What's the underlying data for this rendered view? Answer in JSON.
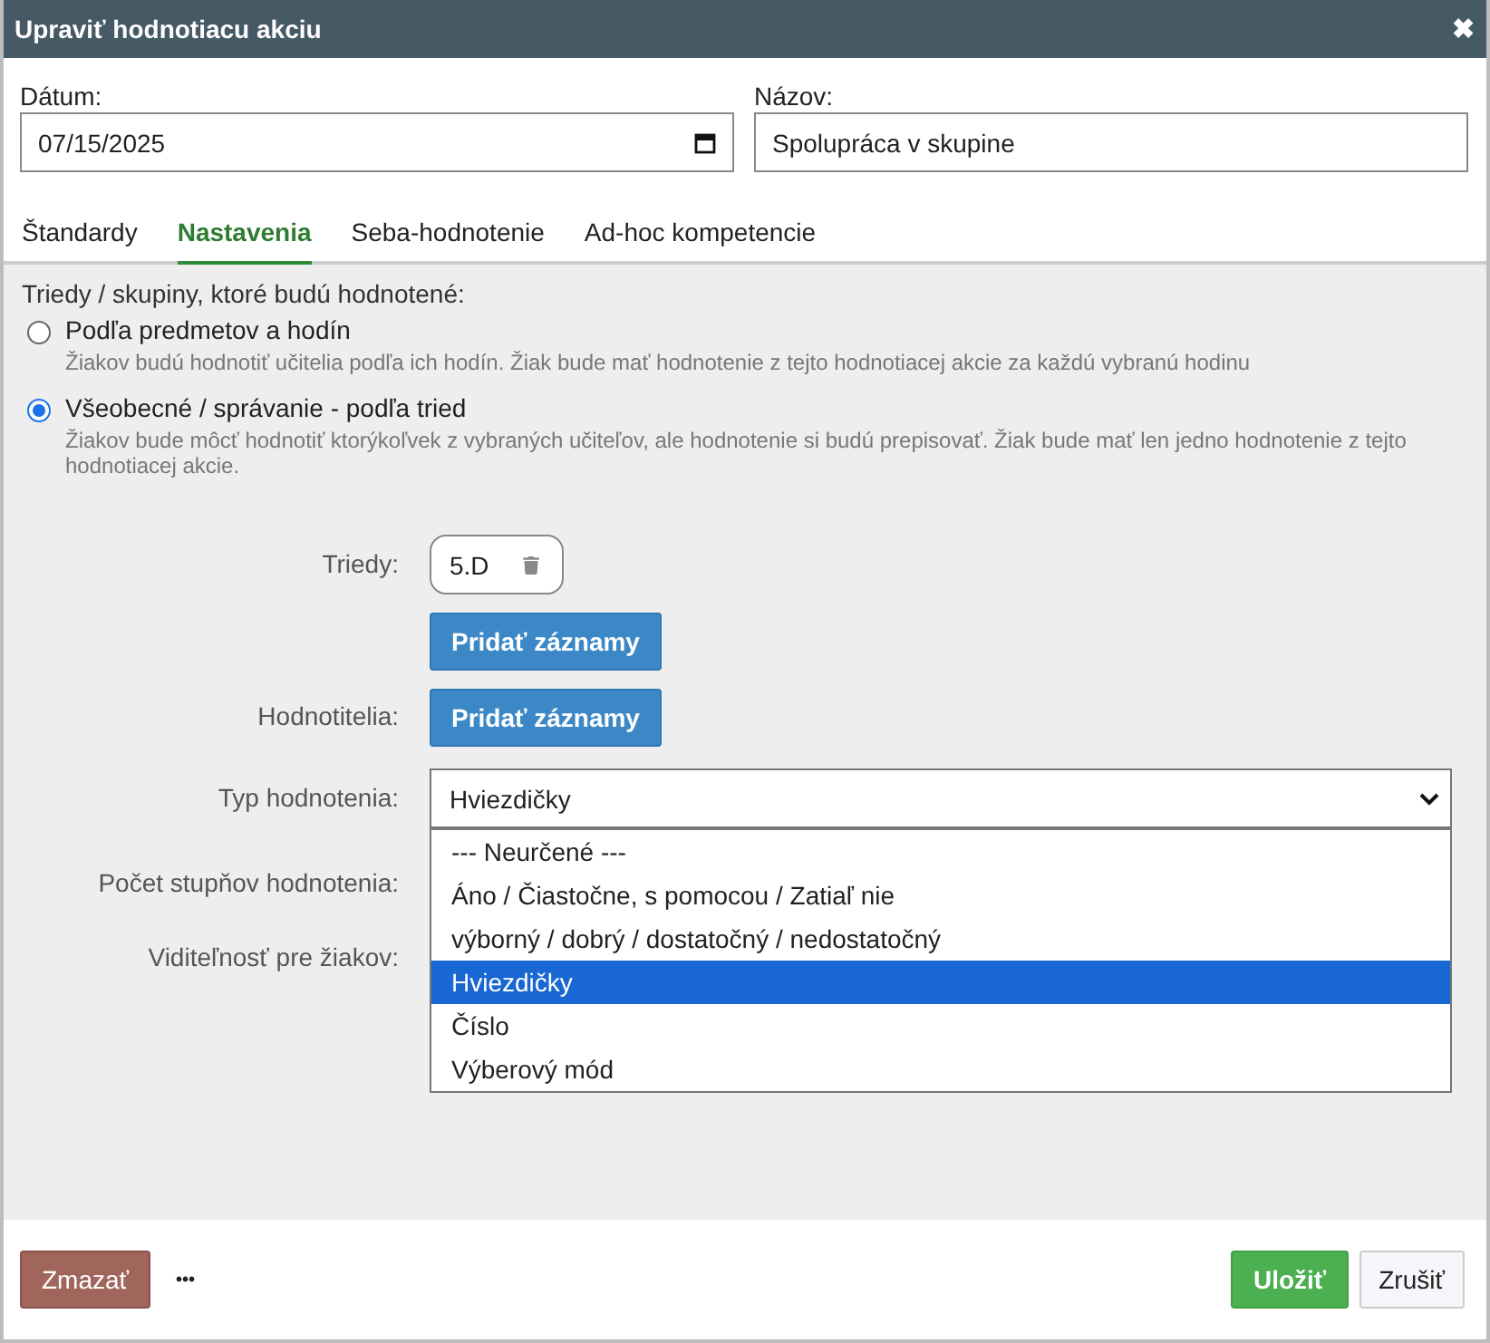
{
  "window": {
    "title": "Upraviť hodnotiacu akciu",
    "close": "✖"
  },
  "fields": [
    {
      "label": "Dátum:",
      "value": "07/15/2025",
      "kind": "date"
    },
    {
      "label": "Názov:",
      "value": "Spolupráca v skupine",
      "kind": "text"
    }
  ],
  "tabs": [
    {
      "label": "Štandardy",
      "selected": false
    },
    {
      "label": "Nastavenia",
      "selected": true
    },
    {
      "label": "Seba-hodnotenie",
      "selected": false
    },
    {
      "label": "Ad-hoc kompetencie",
      "selected": false
    }
  ],
  "scope": {
    "label": "Triedy / skupiny, ktoré budú hodnotené:",
    "options": [
      {
        "label": "Podľa predmetov a hodín",
        "hint": "Žiakov budú hodnotiť učitelia podľa ich hodín. Žiak bude mať hodnotenie z tejto hodnotiacej akcie za každú vybranú hodinu",
        "selected": false
      },
      {
        "label": "Všeobecné / správanie - podľa tried",
        "hint": "Žiakov bude môcť hodnotiť ktorýkoľvek z vybraných učiteľov, ale hodnotenie si budú prepisovať. Žiak bude mať len jedno hodnotenie z tejto hodnotiacej akcie.",
        "selected": true
      }
    ]
  },
  "rows": [
    {
      "kind": "chips",
      "label": "Triedy:",
      "chips": [
        "5.D"
      ],
      "button": "Pridať záznamy"
    },
    {
      "kind": "button",
      "label": "Hodnotitelia:",
      "button": "Pridať záznamy"
    },
    {
      "kind": "select",
      "label": "Typ hodnotenia:",
      "value": "Hviezdičky",
      "options": [
        {
          "label": "--- Neurčené ---",
          "selected": false
        },
        {
          "label": "Áno / Čiastočne, s pomocou / Zatiaľ nie",
          "selected": false
        },
        {
          "label": "výborný / dobrý / dostatočný / nedostatočný",
          "selected": false
        },
        {
          "label": "Hviezdičky",
          "selected": true
        },
        {
          "label": "Číslo",
          "selected": false
        },
        {
          "label": "Výberový mód",
          "selected": false
        }
      ]
    },
    {
      "kind": "hidden",
      "label": "Počet stupňov hodnotenia:"
    },
    {
      "kind": "hidden",
      "label": "Viditeľnosť pre žiakov:"
    }
  ],
  "footer": {
    "delete": "Zmazať",
    "more": "•••",
    "save": "Uložiť",
    "cancel": "Zrušiť"
  }
}
